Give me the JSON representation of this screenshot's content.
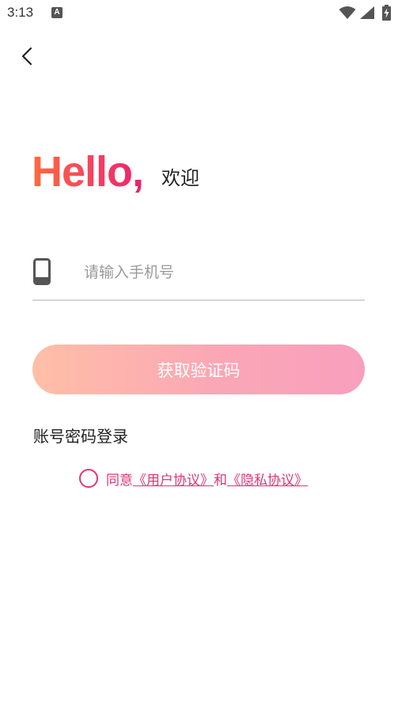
{
  "status_bar": {
    "time": "3:13",
    "notification_letter": "A"
  },
  "login": {
    "greeting": "Hello,",
    "welcome": "欢迎",
    "phone_placeholder": "请输入手机号",
    "get_code_label": "获取验证码",
    "password_login_label": "账号密码登录"
  },
  "agreement": {
    "agree_text": "同意",
    "user_agreement": "《用户协议》",
    "and_text": "和",
    "privacy_agreement": "《隐私协议》",
    "checked": false
  },
  "colors": {
    "accent": "#e0357a",
    "hello_gradient_start": "#ff6b3d",
    "hello_gradient_end": "#e8236e",
    "button_gradient_start": "#ffbfa6",
    "button_gradient_end": "#f89fbd"
  },
  "icons": {
    "back": "chevron-left-icon",
    "phone": "phone-icon",
    "wifi": "wifi-icon",
    "signal": "signal-icon",
    "battery": "battery-icon"
  }
}
